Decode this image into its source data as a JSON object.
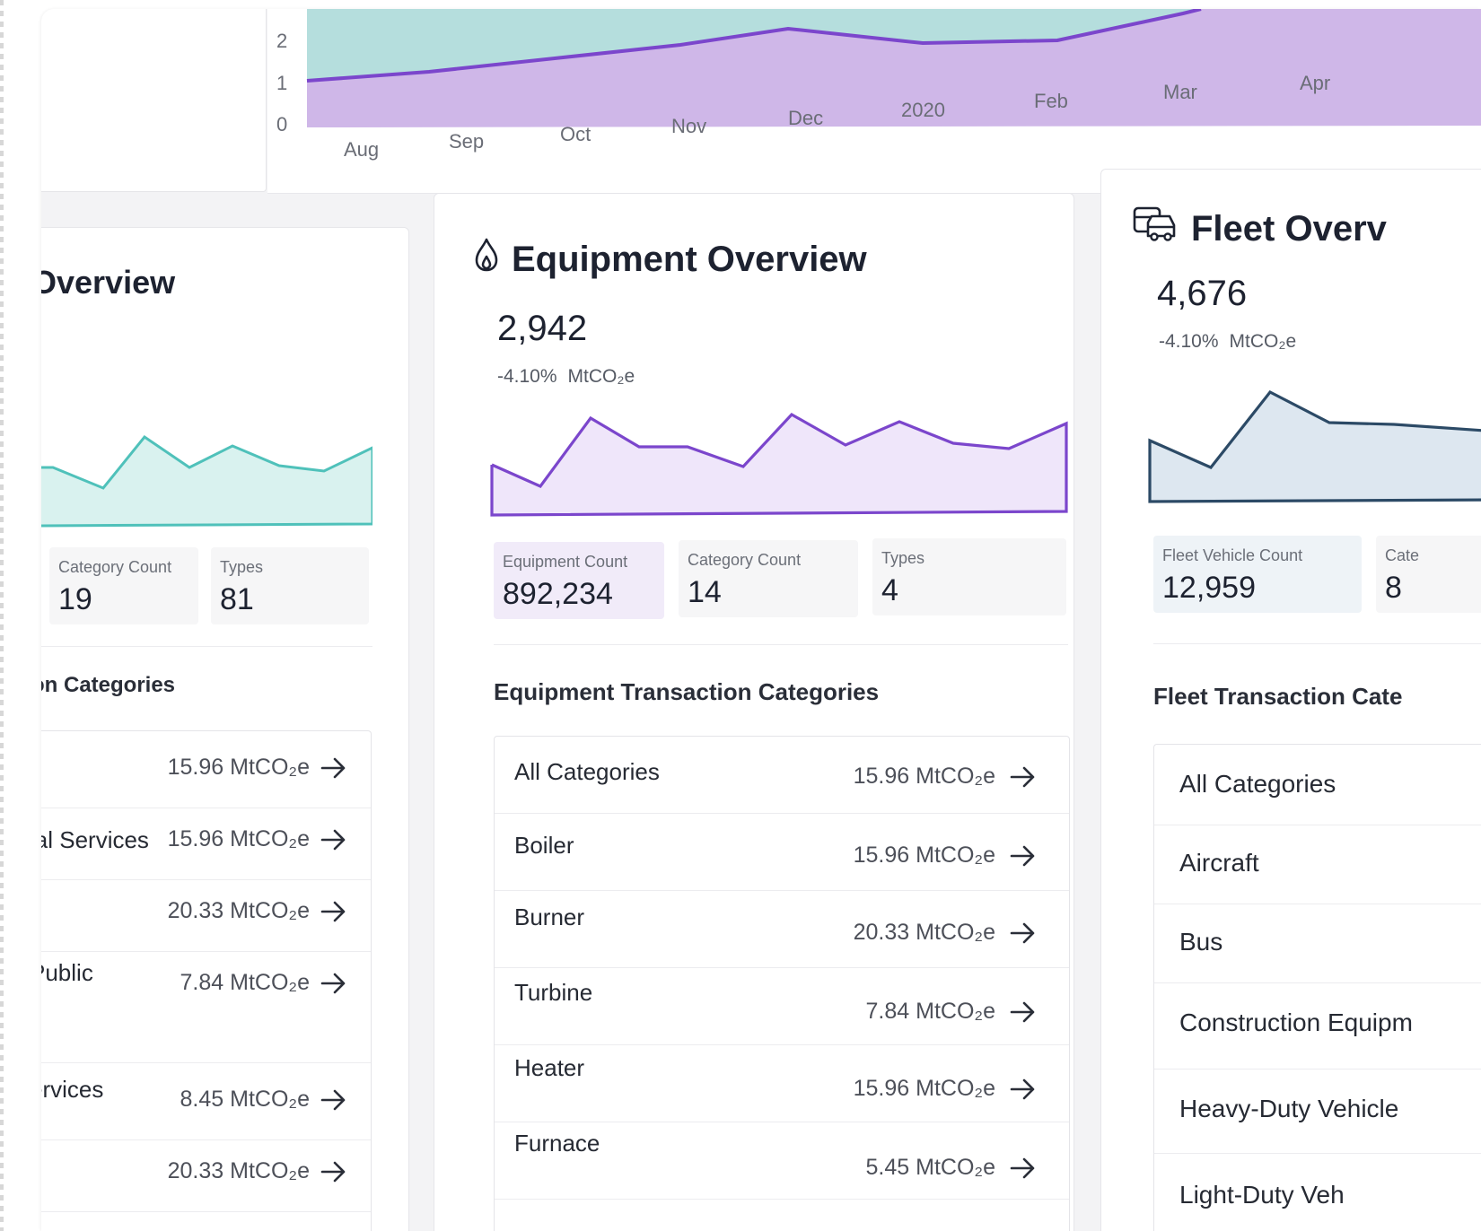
{
  "top_chart": {
    "y_ticks": [
      "2",
      "1",
      "0"
    ],
    "x_ticks": [
      "Aug",
      "Sep",
      "Oct",
      "Nov",
      "Dec",
      "2020",
      "Feb",
      "Mar",
      "Apr"
    ],
    "colors": {
      "teal_area": "#b5dedd",
      "purple_area": "#cfb7e8",
      "purple_line": "#7b46cc"
    }
  },
  "left_card": {
    "title": "Overview",
    "stats": [
      {
        "label": "Category Count",
        "value": "19"
      },
      {
        "label": "Types",
        "value": "81"
      }
    ],
    "section_title": "on Categories",
    "rows": [
      {
        "name": "",
        "amount": "15.96 MtCO₂e"
      },
      {
        "name": "ial Services",
        "amount": "15.96 MtCO₂e"
      },
      {
        "name": "",
        "amount": "20.33 MtCO₂e"
      },
      {
        "name": "Public",
        "amount": "7.84 MtCO₂e"
      },
      {
        "name": "ervices",
        "amount": "8.45 MtCO₂e"
      },
      {
        "name": "",
        "amount": "20.33 MtCO₂e"
      }
    ],
    "colors": {
      "line": "#4fc1ba",
      "fill": "#d9f2ef"
    }
  },
  "equipment_card": {
    "icon": "flame-icon",
    "title": "Equipment Overview",
    "total": "2,942",
    "delta": "-4.10%",
    "unit": "MtCO₂e",
    "stats": [
      {
        "label": "Equipment Count",
        "value": "892,234"
      },
      {
        "label": "Category Count",
        "value": "14"
      },
      {
        "label": "Types",
        "value": "4"
      }
    ],
    "section_title": "Equipment Transaction Categories",
    "rows": [
      {
        "name": "All Categories",
        "amount": "15.96 MtCO₂e"
      },
      {
        "name": "Boiler",
        "amount": "15.96 MtCO₂e"
      },
      {
        "name": "Burner",
        "amount": "20.33 MtCO₂e"
      },
      {
        "name": "Turbine",
        "amount": "7.84 MtCO₂e"
      },
      {
        "name": "Heater",
        "amount": "15.96 MtCO₂e"
      },
      {
        "name": "Furnace",
        "amount": "5.45 MtCO₂e"
      }
    ],
    "colors": {
      "line": "#7b46cc",
      "fill": "#efe6fa",
      "highlight_stat": "#f1ebf9"
    }
  },
  "fleet_card": {
    "icon": "vehicles-icon",
    "title": "Fleet Overv",
    "total": "4,676",
    "delta": "-4.10%",
    "unit": "MtCO₂e",
    "stats": [
      {
        "label": "Fleet Vehicle Count",
        "value": "12,959"
      },
      {
        "label": "Cate",
        "value": "8"
      }
    ],
    "section_title": "Fleet Transaction Cate",
    "rows": [
      {
        "name": "All Categories"
      },
      {
        "name": "Aircraft"
      },
      {
        "name": "Bus"
      },
      {
        "name": "Construction Equipm"
      },
      {
        "name": "Heavy-Duty Vehicle"
      },
      {
        "name": "Light-Duty Veh"
      }
    ],
    "colors": {
      "line": "#2c4a66",
      "fill": "#dde7f0",
      "highlight_stat": "#eef3f7"
    }
  }
}
